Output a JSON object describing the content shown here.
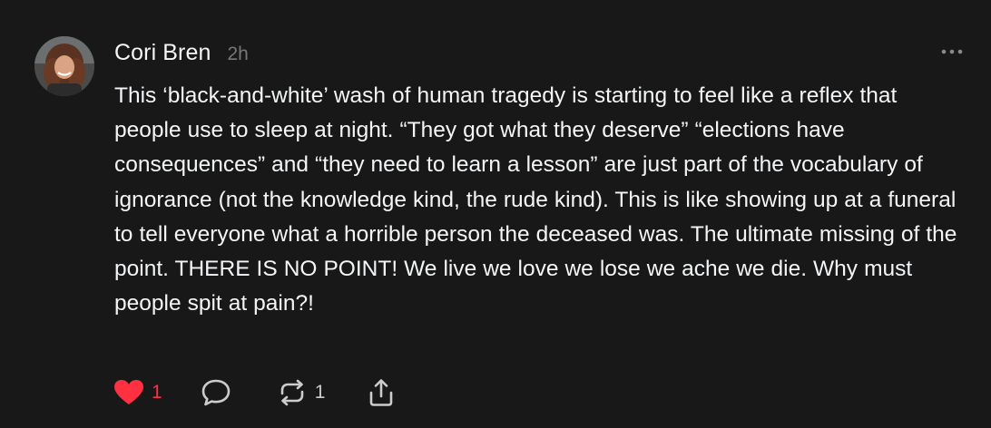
{
  "post": {
    "author": "Cori Bren",
    "time": "2h",
    "body": "This ‘black-and-white’ wash of human tragedy is starting to feel like a reflex that people use to sleep at night. “They got what they deserve” “elections have consequences” and “they need to learn a lesson” are just part of the vocabulary of ignorance (not the knowledge kind, the rude kind). This is like showing up at a funeral to tell everyone what a horrible person the deceased was. The ultimate missing of the point. THERE IS NO POINT! We live we love we lose we ache we die. Why must people spit at pain?!",
    "actions": {
      "like": {
        "icon": "heart-filled-icon",
        "count": "1",
        "color": "#ff3040",
        "liked": true
      },
      "comment": {
        "icon": "speech-bubble-icon"
      },
      "repost": {
        "icon": "repost-arrows-icon",
        "count": "1"
      },
      "share": {
        "icon": "share-upload-icon"
      }
    },
    "more_icon": "ellipsis-icon"
  },
  "theme": {
    "background": "#181818",
    "text": "#f3f5f7",
    "muted": "#777777",
    "like_red": "#ff3040"
  }
}
